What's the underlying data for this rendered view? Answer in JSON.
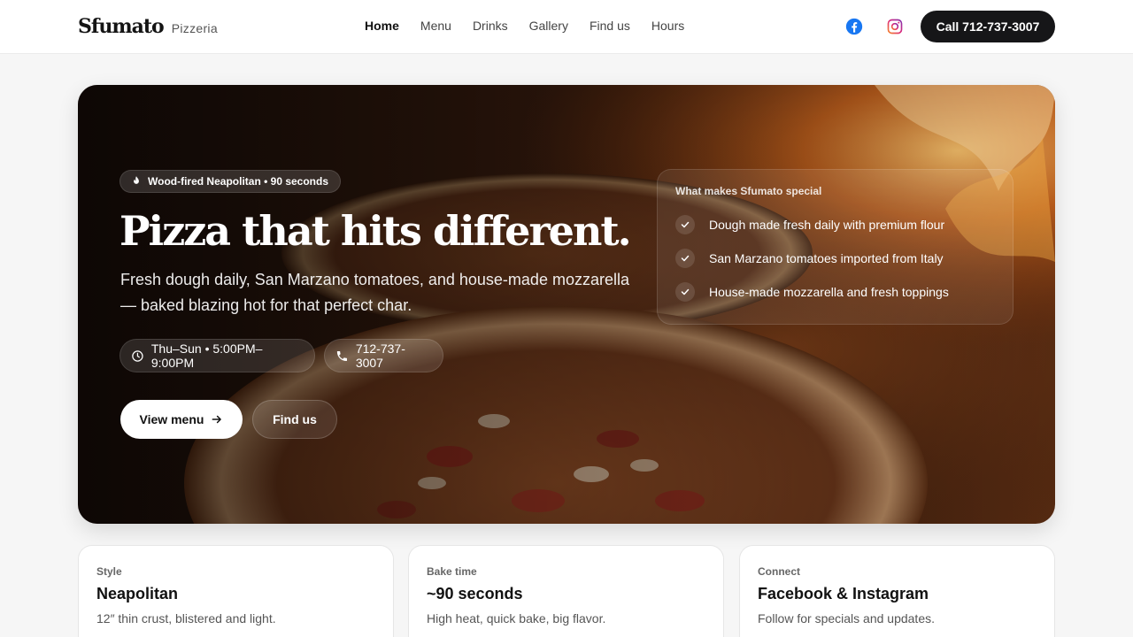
{
  "brand": {
    "name": "Sfumato",
    "tagline": "Pizzeria"
  },
  "nav": {
    "items": [
      {
        "label": "Home",
        "active": true
      },
      {
        "label": "Menu",
        "active": false
      },
      {
        "label": "Drinks",
        "active": false
      },
      {
        "label": "Gallery",
        "active": false
      },
      {
        "label": "Find us",
        "active": false
      },
      {
        "label": "Hours",
        "active": false
      }
    ]
  },
  "header": {
    "social": [
      {
        "icon": "facebook-icon",
        "color": "#1877F2"
      },
      {
        "icon": "instagram-icon",
        "color": "#E1306C"
      }
    ],
    "call_label": "Call 712-737-3007"
  },
  "hero": {
    "badge": "Wood-fired Neapolitan • 90 seconds",
    "title": "Pizza that hits different.",
    "subtitle": "Fresh dough daily, San Marzano tomatoes, and house-made mozzarella — baked blazing hot for that perfect char.",
    "hours": "Thu–Sun • 5:00PM–9:00PM",
    "phone": "712-737-3007",
    "primary_button": "View menu",
    "secondary_button": "Find us",
    "special": {
      "title": "What makes Sfumato special",
      "items": [
        "Dough made fresh daily with premium flour",
        "San Marzano tomatoes imported from Italy",
        "House-made mozzarella and fresh toppings"
      ]
    }
  },
  "cards": [
    {
      "label": "Style",
      "value": "Neapolitan",
      "desc": "12″ thin crust, blistered and light."
    },
    {
      "label": "Bake time",
      "value": "~90 seconds",
      "desc": "High heat, quick bake, big flavor."
    },
    {
      "label": "Connect",
      "value": "Facebook & Instagram",
      "desc": "Follow for specials and updates."
    }
  ],
  "colors": {
    "accent_dark": "#161618",
    "page_bg": "#f6f6f6"
  }
}
